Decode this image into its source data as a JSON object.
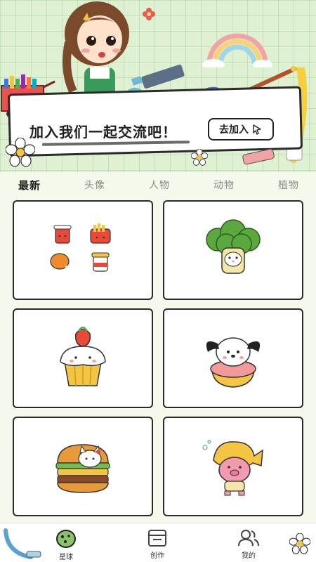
{
  "banner": {
    "slogan": "加入我们一起交流吧！",
    "join_button": "去加入"
  },
  "tabs": [
    {
      "label": "最新",
      "active": true
    },
    {
      "label": "头像",
      "active": false
    },
    {
      "label": "人物",
      "active": false
    },
    {
      "label": "动物",
      "active": false
    },
    {
      "label": "植物",
      "active": false
    }
  ],
  "cards": [
    {
      "icon": "fast-food-set-icon"
    },
    {
      "icon": "broccoli-character-icon"
    },
    {
      "icon": "strawberry-cupcake-icon"
    },
    {
      "icon": "dog-donut-icon"
    },
    {
      "icon": "cat-burger-icon"
    },
    {
      "icon": "pig-fish-hat-icon"
    }
  ],
  "nav": {
    "planet": "星球",
    "create": "创作",
    "mine": "我的"
  },
  "colors": {
    "banner_bg": "#dff1d2",
    "page_bg": "#f4f9ec",
    "card_border": "#2a2a2a",
    "active_tab": "#1e1e1e",
    "inactive_tab": "#8a8a8a"
  }
}
